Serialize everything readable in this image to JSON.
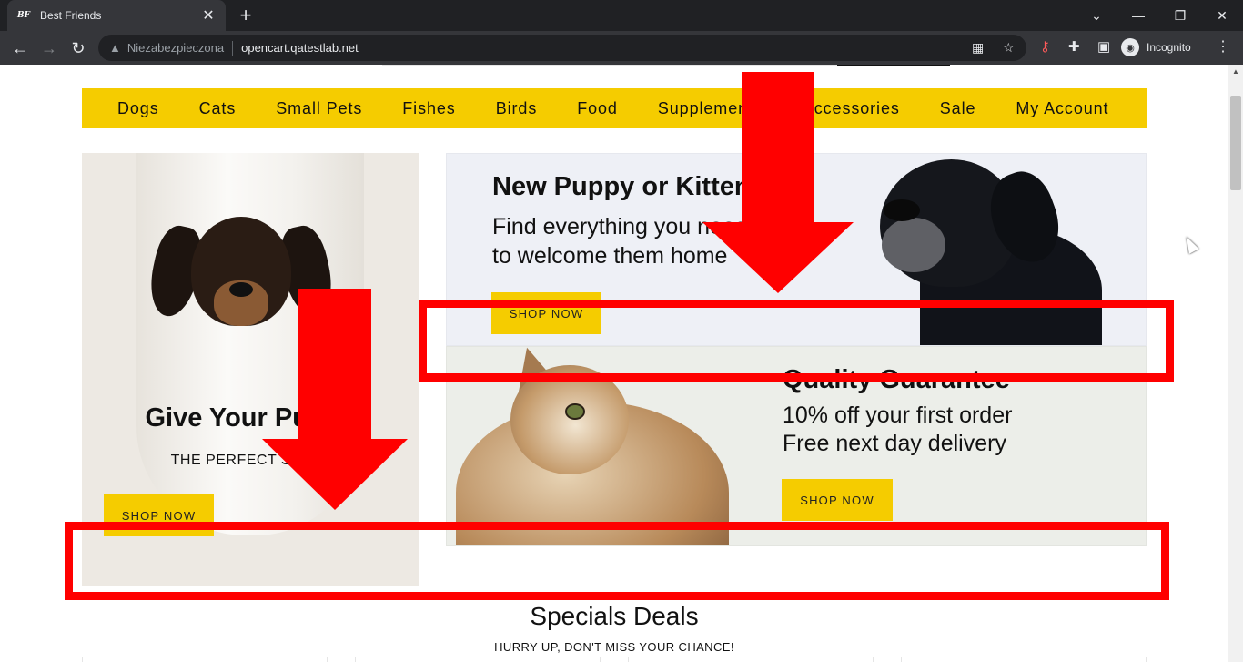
{
  "browser": {
    "tab": {
      "favicon": "BF",
      "title": "Best Friends",
      "close": "✕"
    },
    "new_tab": "+",
    "window_controls": {
      "dropdown": "⌄",
      "minimize": "—",
      "restore": "❐",
      "close": "✕"
    },
    "nav": {
      "back": "←",
      "forward": "→",
      "reload": "↻"
    },
    "security_label": "Niezabezpieczona",
    "url": "opencart.qatestlab.net",
    "profile_label": "Incognito"
  },
  "menu": [
    "Dogs",
    "Cats",
    "Small Pets",
    "Fishes",
    "Birds",
    "Food",
    "Supplements",
    "Accessories",
    "Sale",
    "My Account"
  ],
  "banner_left": {
    "title": "Give Your Puppy",
    "subtitle": "THE PERFECT START",
    "button": "SHOP NOW"
  },
  "banner_right_top": {
    "title": "New Puppy or Kitten?",
    "subtitle": "Find everything you need to welcome them home",
    "button": "SHOP NOW"
  },
  "banner_right_bottom": {
    "title": "Quality Guarantee",
    "line1": "10% off your first order",
    "line2": "Free next day delivery",
    "button": "SHOP NOW"
  },
  "specials": {
    "title": "Specials Deals",
    "subtitle": "HURRY UP, DON'T MISS YOUR CHANCE!"
  },
  "colors": {
    "accent": "#f5cc00",
    "annotation": "#ff0000",
    "chrome_dark": "#202124",
    "chrome_toolbar": "#35363a"
  }
}
